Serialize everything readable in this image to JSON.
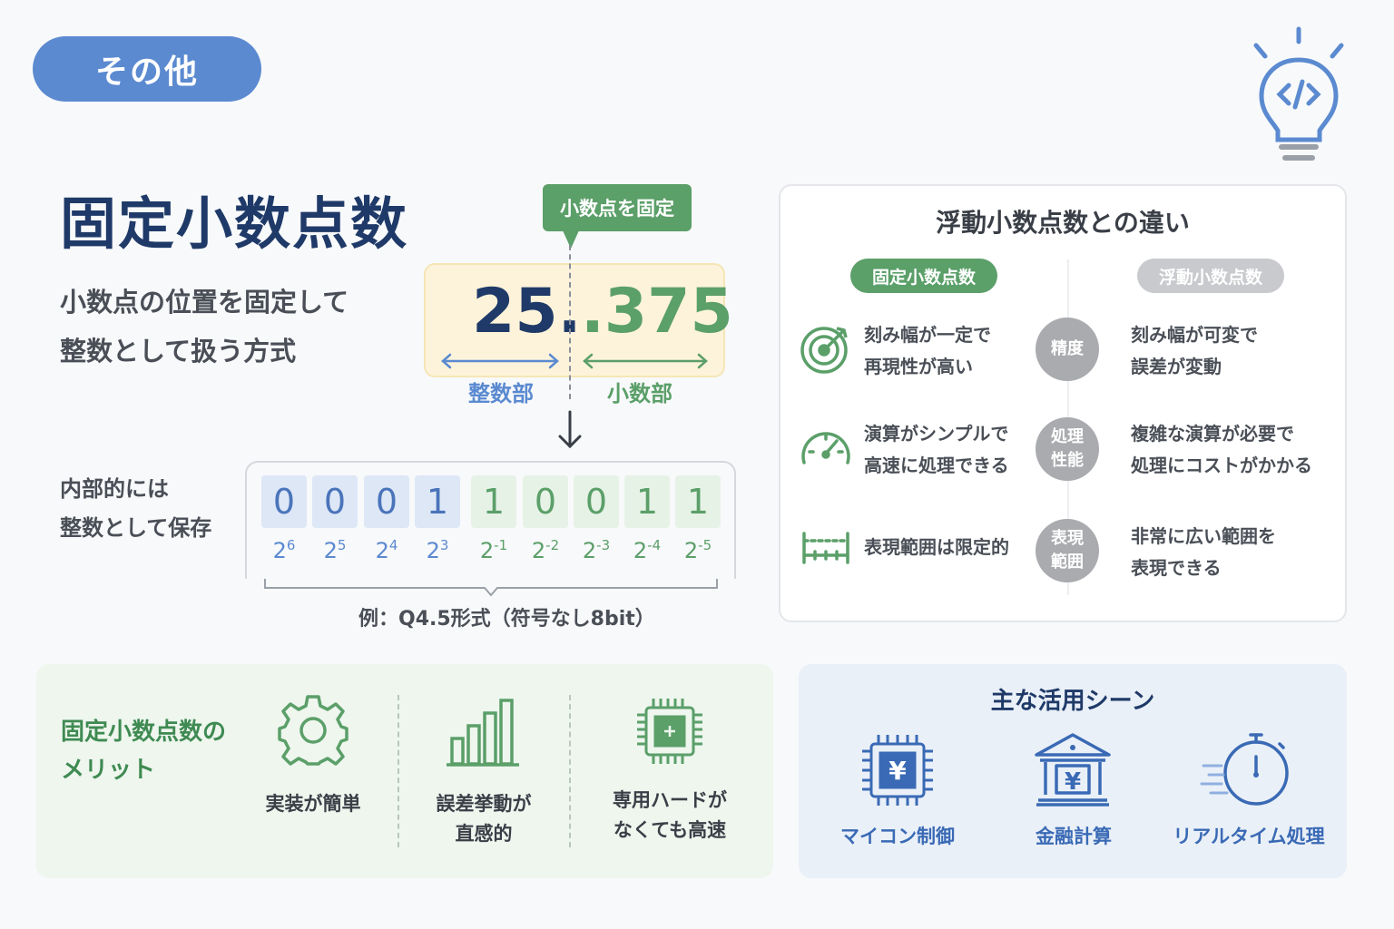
{
  "category": "その他",
  "title": "固定小数点数",
  "description": [
    "小数点の位置を固定して",
    "整数として扱う方式"
  ],
  "demo": {
    "fix_tag": "小数点を固定",
    "integer_part": "25.",
    "fraction_part": ".375",
    "integer_label": "整数部",
    "fraction_label": "小数部"
  },
  "storage": {
    "label": [
      "内部的には",
      "整数として保存"
    ],
    "bits": [
      {
        "value": "0",
        "base": "2",
        "exp": "6",
        "part": "int"
      },
      {
        "value": "0",
        "base": "2",
        "exp": "5",
        "part": "int"
      },
      {
        "value": "0",
        "base": "2",
        "exp": "4",
        "part": "int"
      },
      {
        "value": "1",
        "base": "2",
        "exp": "3",
        "part": "int"
      },
      {
        "value": "1",
        "base": "2",
        "exp": "-1",
        "part": "frac"
      },
      {
        "value": "0",
        "base": "2",
        "exp": "-2",
        "part": "frac"
      },
      {
        "value": "0",
        "base": "2",
        "exp": "-3",
        "part": "frac"
      },
      {
        "value": "1",
        "base": "2",
        "exp": "-4",
        "part": "frac"
      },
      {
        "value": "1",
        "base": "2",
        "exp": "-5",
        "part": "frac"
      }
    ],
    "example": "例：Q4.5形式（符号なし8bit）"
  },
  "comparison": {
    "title": "浮動小数点数との違い",
    "fixed_label": "固定小数点数",
    "float_label": "浮動小数点数",
    "rows": [
      {
        "icon": "target-icon",
        "fixed": [
          "刻み幅が一定で",
          "再現性が高い"
        ],
        "aspect": [
          "精度"
        ],
        "float": [
          "刻み幅が可変で",
          "誤差が変動"
        ]
      },
      {
        "icon": "speedometer-icon",
        "fixed": [
          "演算がシンプルで",
          "高速に処理できる"
        ],
        "aspect": [
          "処理",
          "性能"
        ],
        "float": [
          "複雑な演算が必要で",
          "処理にコストがかかる"
        ]
      },
      {
        "icon": "range-icon",
        "fixed": [
          "表現範囲は限定的"
        ],
        "aspect": [
          "表現",
          "範囲"
        ],
        "float": [
          "非常に広い範囲を",
          "表現できる"
        ]
      }
    ]
  },
  "merits": {
    "title": [
      "固定小数点数の",
      "メリット"
    ],
    "items": [
      {
        "icon": "gear-icon",
        "label": [
          "実装が簡単"
        ]
      },
      {
        "icon": "bar-chart-icon",
        "label": [
          "誤差挙動が",
          "直感的"
        ]
      },
      {
        "icon": "chip-icon",
        "label": [
          "専用ハードが",
          "なくても高速"
        ]
      }
    ]
  },
  "use_cases": {
    "title": "主な活用シーン",
    "items": [
      {
        "icon": "microcontroller-yen-icon",
        "label": "マイコン制御"
      },
      {
        "icon": "bank-yen-icon",
        "label": "金融計算"
      },
      {
        "icon": "stopwatch-icon",
        "label": "リアルタイム処理"
      }
    ]
  },
  "colors": {
    "accent_blue": "#5b8ad0",
    "navy": "#1f3a68",
    "green": "#5b9f69",
    "gray": "#a9abae"
  }
}
